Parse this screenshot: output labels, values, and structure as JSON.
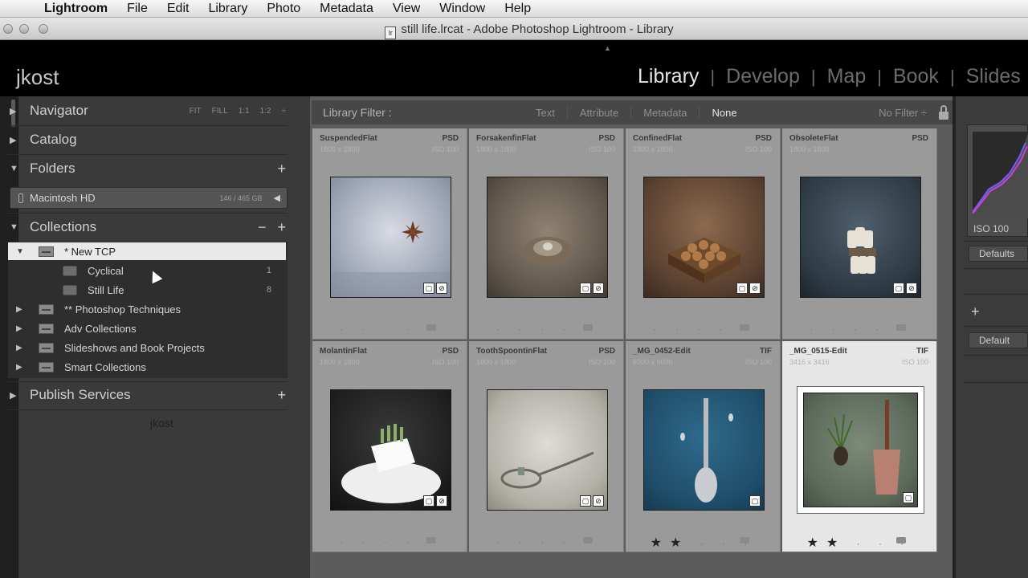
{
  "menubar": {
    "items": [
      "Lightroom",
      "File",
      "Edit",
      "Library",
      "Photo",
      "Metadata",
      "View",
      "Window",
      "Help"
    ]
  },
  "window": {
    "title": "still life.lrcat - Adobe Photoshop Lightroom - Library",
    "doc_icon_text": "lr"
  },
  "identity": "jkost",
  "modules": [
    "Library",
    "Develop",
    "Map",
    "Book",
    "Slides"
  ],
  "left_panel": {
    "navigator": {
      "label": "Navigator",
      "zoom_options": [
        "FIT",
        "FILL",
        "1:1",
        "1:2"
      ]
    },
    "catalog": {
      "label": "Catalog"
    },
    "folders": {
      "label": "Folders",
      "volume": {
        "name": "Macintosh HD",
        "size": "146 / 465 GB"
      }
    },
    "collections": {
      "label": "Collections",
      "items": [
        {
          "name": "* New TCP",
          "count": ""
        },
        {
          "name": "Cyclical",
          "count": "1"
        },
        {
          "name": "Still Life",
          "count": "8"
        },
        {
          "name": "** Photoshop Techniques",
          "count": ""
        },
        {
          "name": "Adv Collections",
          "count": ""
        },
        {
          "name": "Slideshows and Book Projects",
          "count": ""
        },
        {
          "name": "Smart Collections",
          "count": ""
        }
      ]
    },
    "publish": {
      "label": "Publish Services"
    },
    "identity_footer": "jkost"
  },
  "filter_bar": {
    "label": "Library Filter :",
    "options": [
      "Text",
      "Attribute",
      "Metadata",
      "None"
    ],
    "preset": "No Filter ÷"
  },
  "grid": {
    "cells": [
      {
        "filename": "SuspendedFlat",
        "ext": "PSD",
        "dims": "1800 x 1800",
        "iso": "ISO 100",
        "rating": 0
      },
      {
        "filename": "ForsakenfinFlat",
        "ext": "PSD",
        "dims": "1800 x 1800",
        "iso": "ISO 100",
        "rating": 0
      },
      {
        "filename": "ConfinedFlat",
        "ext": "PSD",
        "dims": "1800 x 1800",
        "iso": "ISO 100",
        "rating": 0
      },
      {
        "filename": "ObsoleteFlat",
        "ext": "PSD",
        "dims": "1800 x 1800",
        "iso": "",
        "rating": 0
      },
      {
        "filename": "MolantinFlat",
        "ext": "PSD",
        "dims": "1800 x 1800",
        "iso": "ISO 100",
        "rating": 0
      },
      {
        "filename": "ToothSpoontinFlat",
        "ext": "PSD",
        "dims": "1800 x 1800",
        "iso": "ISO 100",
        "rating": 0
      },
      {
        "filename": "_MG_0452-Edit",
        "ext": "TIF",
        "dims": "6000 x 6000",
        "iso": "ISO 100",
        "rating": 2
      },
      {
        "filename": "_MG_0515-Edit",
        "ext": "TIF",
        "dims": "3416 x 3416",
        "iso": "ISO 100",
        "rating": 2
      }
    ]
  },
  "right_panel": {
    "histogram_iso": "ISO 100",
    "defaults_button": "Defaults",
    "default_button": "Default"
  },
  "colors": {
    "panel_bg": "#3a3a3a",
    "grid_cell": "#9a9a9a",
    "grid_cell_selected": "#e6e6e6",
    "module_active": "#e6e6e6"
  }
}
